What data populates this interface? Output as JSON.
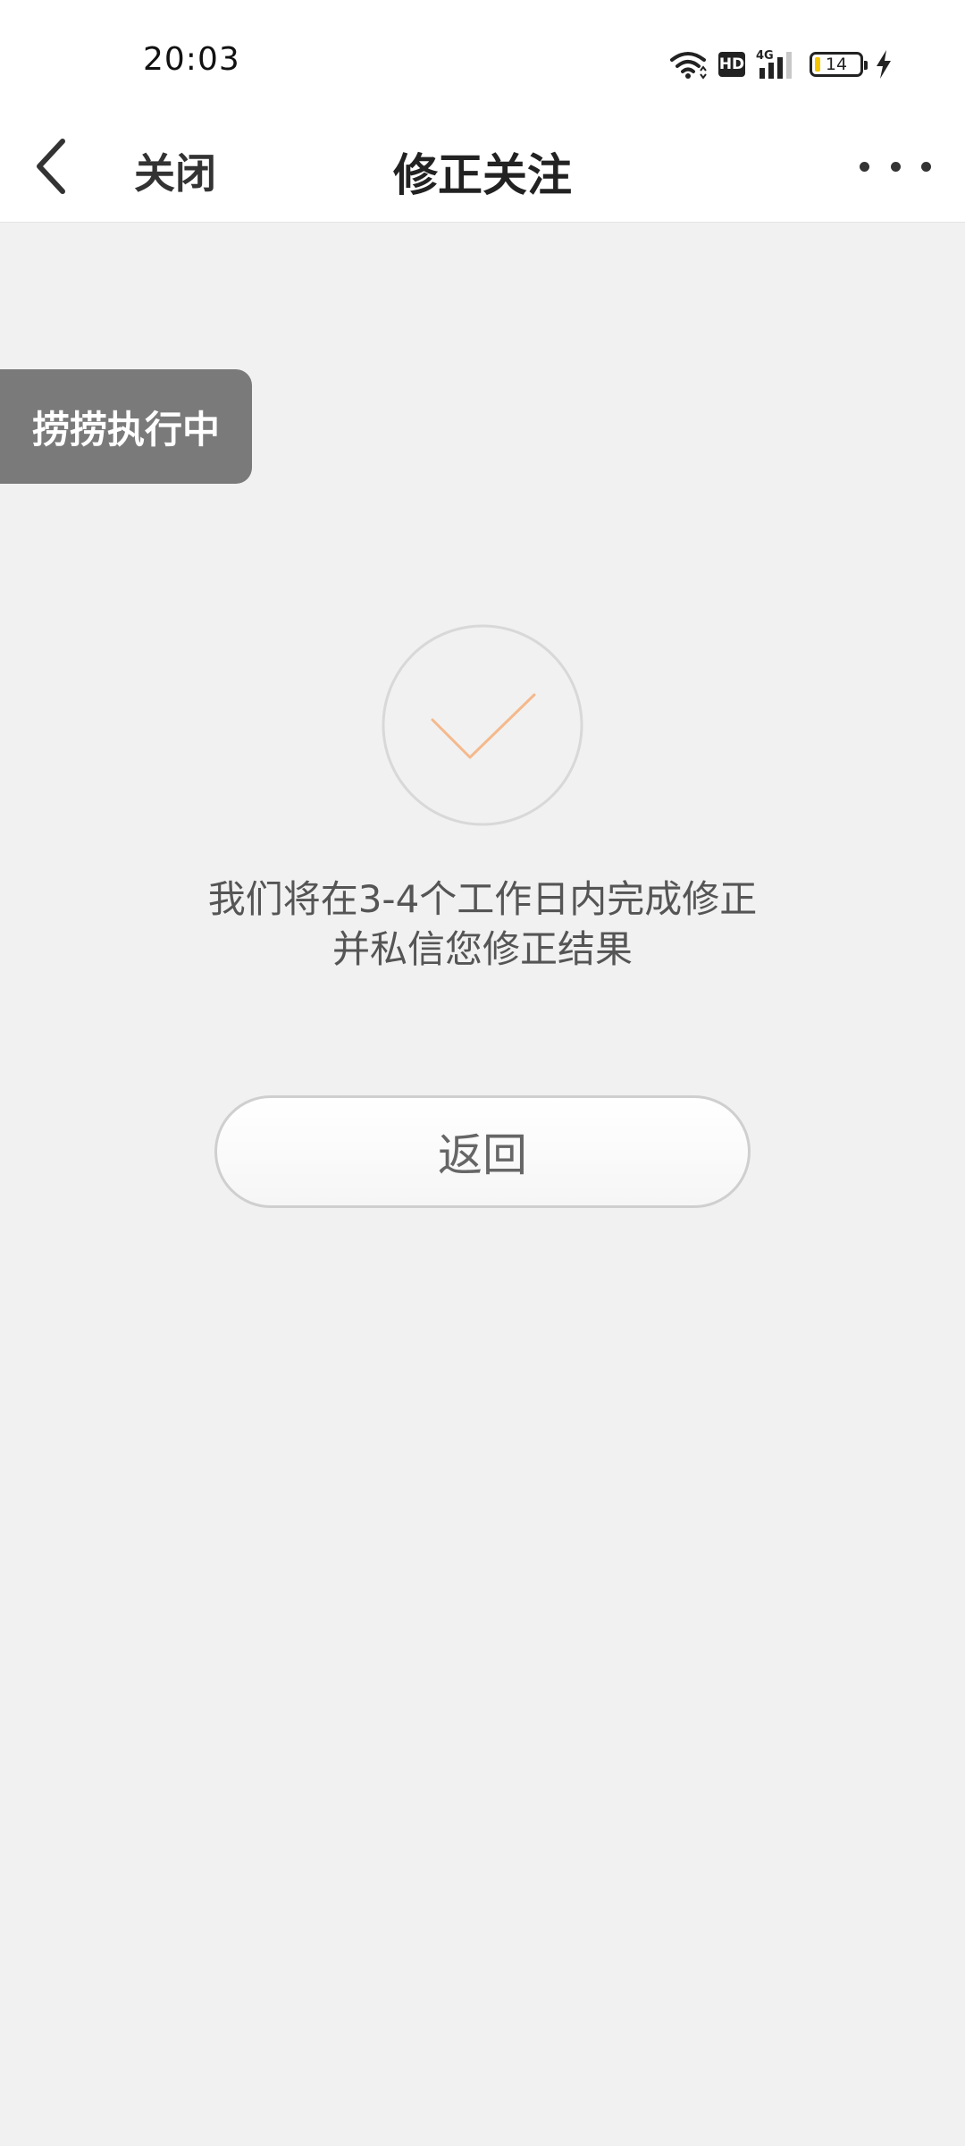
{
  "status_bar": {
    "time": "20:03",
    "hd_label": "HD",
    "network_label": "4G",
    "battery_level": "14",
    "icons": [
      "wifi-icon",
      "hd-icon",
      "signal-4g-icon",
      "battery-icon",
      "charging-icon"
    ]
  },
  "header": {
    "close_label": "关闭",
    "title": "修正关注",
    "back_icon": "chevron-left-icon",
    "more_icon": "more-horizontal-icon"
  },
  "floating_chip": {
    "label": "捞捞执行中"
  },
  "main": {
    "success_icon": "checkmark-circle-icon",
    "message_line1": "我们将在3-4个工作日内完成修正",
    "message_line2": "并私信您修正结果",
    "return_label": "返回"
  },
  "colors": {
    "background": "#f1f1f1",
    "checkmark": "#f5b98c",
    "chip_background": "#7a7a7a"
  }
}
